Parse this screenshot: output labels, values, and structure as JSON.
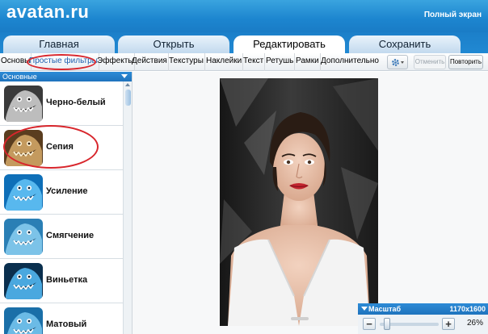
{
  "header": {
    "logo": "avatan.ru",
    "fullscreen": "Полный экран"
  },
  "tabs": [
    {
      "label": "Главная",
      "active": false
    },
    {
      "label": "Открыть",
      "active": false
    },
    {
      "label": "Редактировать",
      "active": true
    },
    {
      "label": "Сохранить",
      "active": false
    }
  ],
  "toolbar": {
    "items": [
      "Основы",
      "Простые фильтры",
      "Эффекты",
      "Действия",
      "Текстуры",
      "Наклейки",
      "Текст",
      "Ретушь",
      "Рамки",
      "Дополнительно"
    ],
    "highlighted": "Простые фильтры",
    "settings_icon": "gear-icon",
    "undo_label": "Отменить",
    "redo_label": "Повторить"
  },
  "category": {
    "selected": "Основные"
  },
  "filters": [
    {
      "label": "Черно-белый",
      "theme": "bw"
    },
    {
      "label": "Сепия",
      "theme": "sepia"
    },
    {
      "label": "Усиление",
      "theme": "blue"
    },
    {
      "label": "Смягчение",
      "theme": "blue"
    },
    {
      "label": "Виньетка",
      "theme": "blue"
    },
    {
      "label": "Матовый",
      "theme": "blue"
    }
  ],
  "zoom": {
    "label": "Масштаб",
    "image_size": "1170x1600",
    "value": "26%",
    "level": 0.26
  },
  "colors": {
    "header": "#1c85cf",
    "annotation": "#d8262c",
    "panel_accent": "#1f73bd"
  }
}
